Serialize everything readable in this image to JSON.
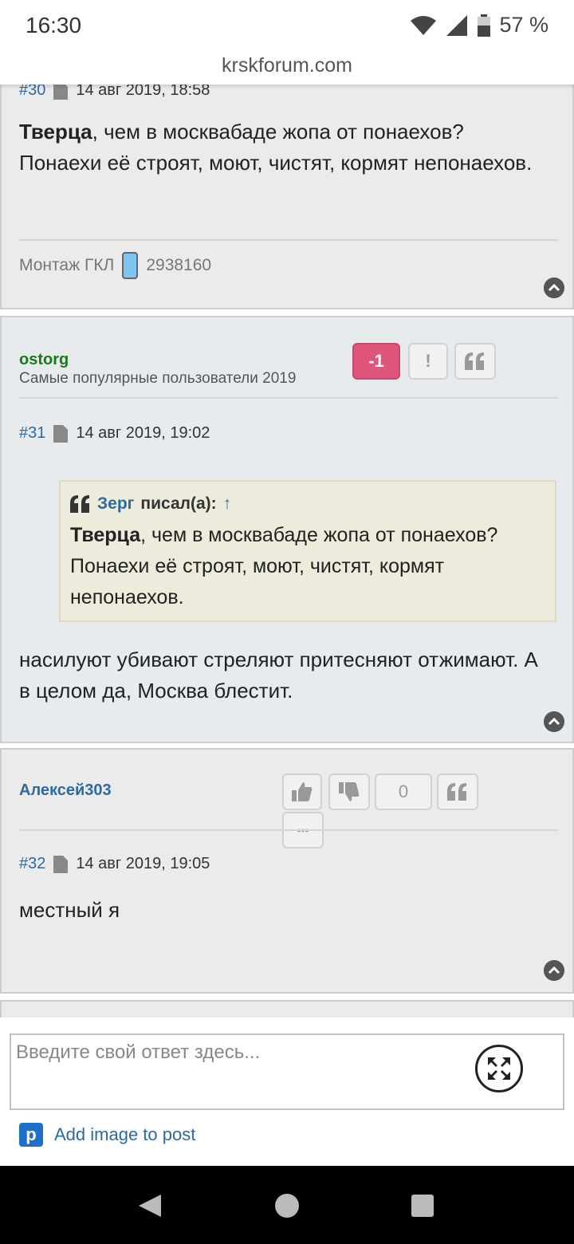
{
  "status": {
    "time": "16:30",
    "battery": "57 %"
  },
  "url": "krskforum.com",
  "posts": [
    {
      "num": "#30",
      "date": "14 авг 2019, 18:58",
      "text_bold": "Тверца",
      "text_rest": ", чем в москвабаде жопа от понаехов? Понаехи её строят, моют, чистят, кормят непонаехов.",
      "signature_text": "Монтаж ГКЛ",
      "signature_number": "2938160"
    },
    {
      "username": "ostorg",
      "usertitle": "Самые популярные пользователи 2019",
      "score": "-1",
      "report_label": "!",
      "num": "#31",
      "date": "14 авг 2019, 19:02",
      "quote": {
        "author": "Зерг",
        "wrote": "писал(а):",
        "arrow": "↑",
        "text_bold": "Тверца",
        "text_rest": ", чем в москвабаде жопа от понаехов? Понаехи её строят, моют, чистят, кормят непонаехов."
      },
      "text": "насилуют убивают стреляют притесняют отжимают. А в целом да, Москва блестит."
    },
    {
      "username": "Алексей303",
      "score": "0",
      "more_label": "•••",
      "num": "#32",
      "date": "14 авг 2019, 19:05",
      "text": "местный я"
    }
  ],
  "reply": {
    "placeholder": "Введите свой ответ здесь...",
    "add_image": "Add image to post"
  },
  "colors": {
    "link": "#2c6aa0",
    "username_green": "#1a7a1a",
    "negative_score": "#e0557b"
  }
}
